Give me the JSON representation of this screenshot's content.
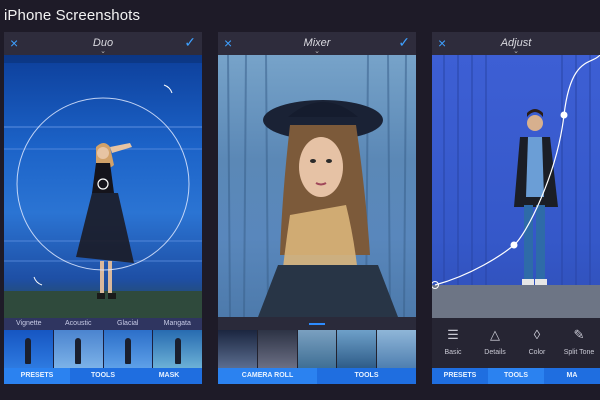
{
  "page": {
    "title": "iPhone Screenshots"
  },
  "phones": {
    "duo": {
      "title": "Duo",
      "filters": [
        "Vignette",
        "Acoustic",
        "Glacial",
        "Mangata"
      ],
      "tabs": [
        "PRESETS",
        "TOOLS",
        "MASK"
      ]
    },
    "mixer": {
      "title": "Mixer",
      "tabs": [
        "CAMERA ROLL",
        "TOOLS"
      ]
    },
    "adjust": {
      "title": "Adjust",
      "tools": [
        "Basic",
        "Details",
        "Color",
        "Split Tone"
      ],
      "tabs": [
        "PRESETS",
        "TOOLS",
        "MA"
      ]
    }
  },
  "icons": {
    "close": "×",
    "check": "✓",
    "chevron": "⌄",
    "sliders": "☰",
    "triangle": "△",
    "drop": "◊",
    "pencil": "✎"
  },
  "colors": {
    "accent": "#3ea0ff",
    "tabbar": "#1f6ee0",
    "background": "#1e1b28"
  }
}
